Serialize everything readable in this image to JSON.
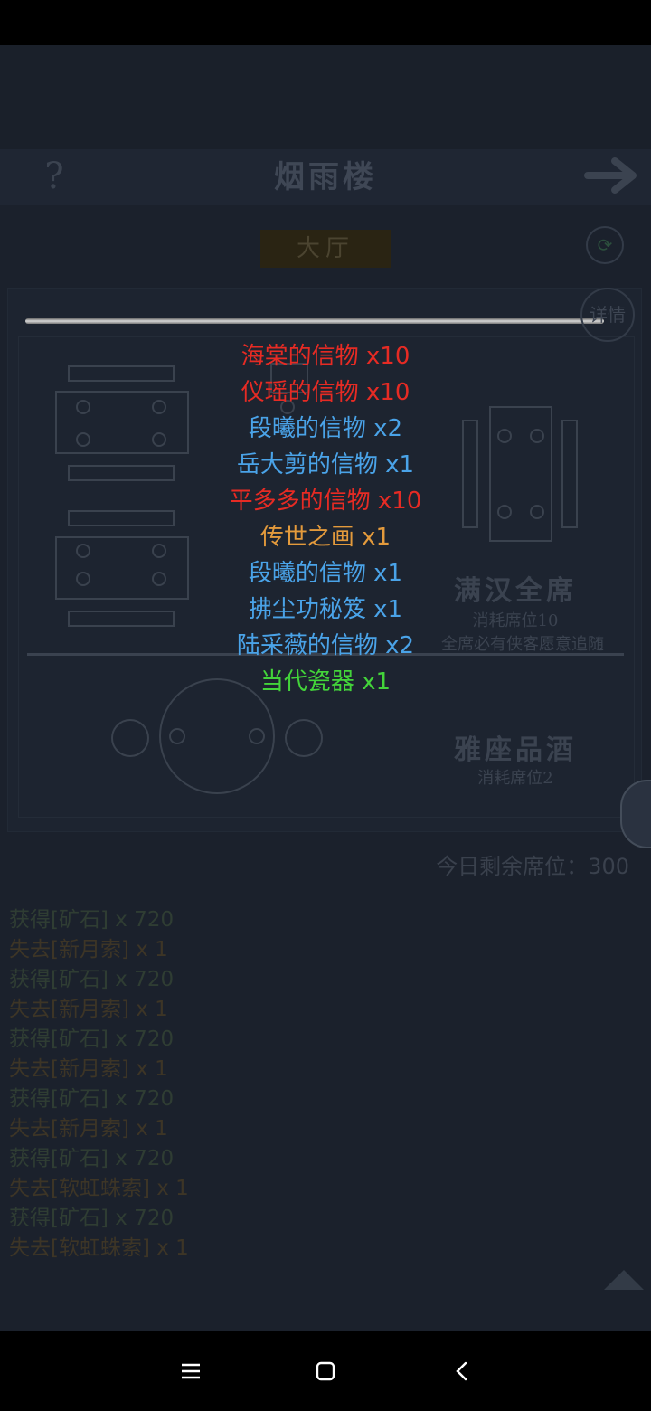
{
  "header": {
    "help_label": "?",
    "title": "烟雨楼",
    "next_icon": "arrow-right-icon"
  },
  "tabs": {
    "hall": "大厅"
  },
  "side_buttons": {
    "refresh_icon": "refresh-icon",
    "detail_label": "详情"
  },
  "options": [
    {
      "title": "满汉全席",
      "cost": "消耗席位10",
      "desc": "全席必有侠客愿意追随"
    },
    {
      "title": "雅座品酒",
      "cost": "消耗席位2"
    }
  ],
  "seats_remaining": "今日剩余席位：300",
  "rewards": [
    {
      "text": "海棠的信物 x10",
      "color": "#e62b24"
    },
    {
      "text": "仪瑶的信物 x10",
      "color": "#e62b24"
    },
    {
      "text": "段曦的信物 x2",
      "color": "#4aa3e8"
    },
    {
      "text": "岳大剪的信物 x1",
      "color": "#4aa3e8"
    },
    {
      "text": "平多多的信物 x10",
      "color": "#e62b24"
    },
    {
      "text": "传世之画 x1",
      "color": "#e39a3c"
    },
    {
      "text": "段曦的信物 x1",
      "color": "#4aa3e8"
    },
    {
      "text": "拂尘功秘笈 x1",
      "color": "#4aa3e8"
    },
    {
      "text": "陆采薇的信物 x2",
      "color": "#4aa3e8"
    },
    {
      "text": "当代瓷器 x1",
      "color": "#43d43a"
    }
  ],
  "log": [
    {
      "text": "获得[矿石] x 720",
      "type": "gain"
    },
    {
      "text": "失去[新月索] x 1",
      "type": "loss"
    },
    {
      "text": "获得[矿石] x 720",
      "type": "gain"
    },
    {
      "text": "失去[新月索] x 1",
      "type": "loss"
    },
    {
      "text": "获得[矿石] x 720",
      "type": "gain"
    },
    {
      "text": "失去[新月索] x 1",
      "type": "loss"
    },
    {
      "text": "获得[矿石] x 720",
      "type": "gain"
    },
    {
      "text": "失去[新月索] x 1",
      "type": "loss"
    },
    {
      "text": "获得[矿石] x 720",
      "type": "gain"
    },
    {
      "text": "失去[软虹蛛索] x 1",
      "type": "loss"
    },
    {
      "text": "获得[矿石] x 720",
      "type": "gain"
    },
    {
      "text": "失去[软虹蛛索] x 1",
      "type": "loss"
    }
  ],
  "navbar": {
    "menu_icon": "menu-icon",
    "home_icon": "home-square-icon",
    "back_icon": "back-chevron-icon"
  }
}
